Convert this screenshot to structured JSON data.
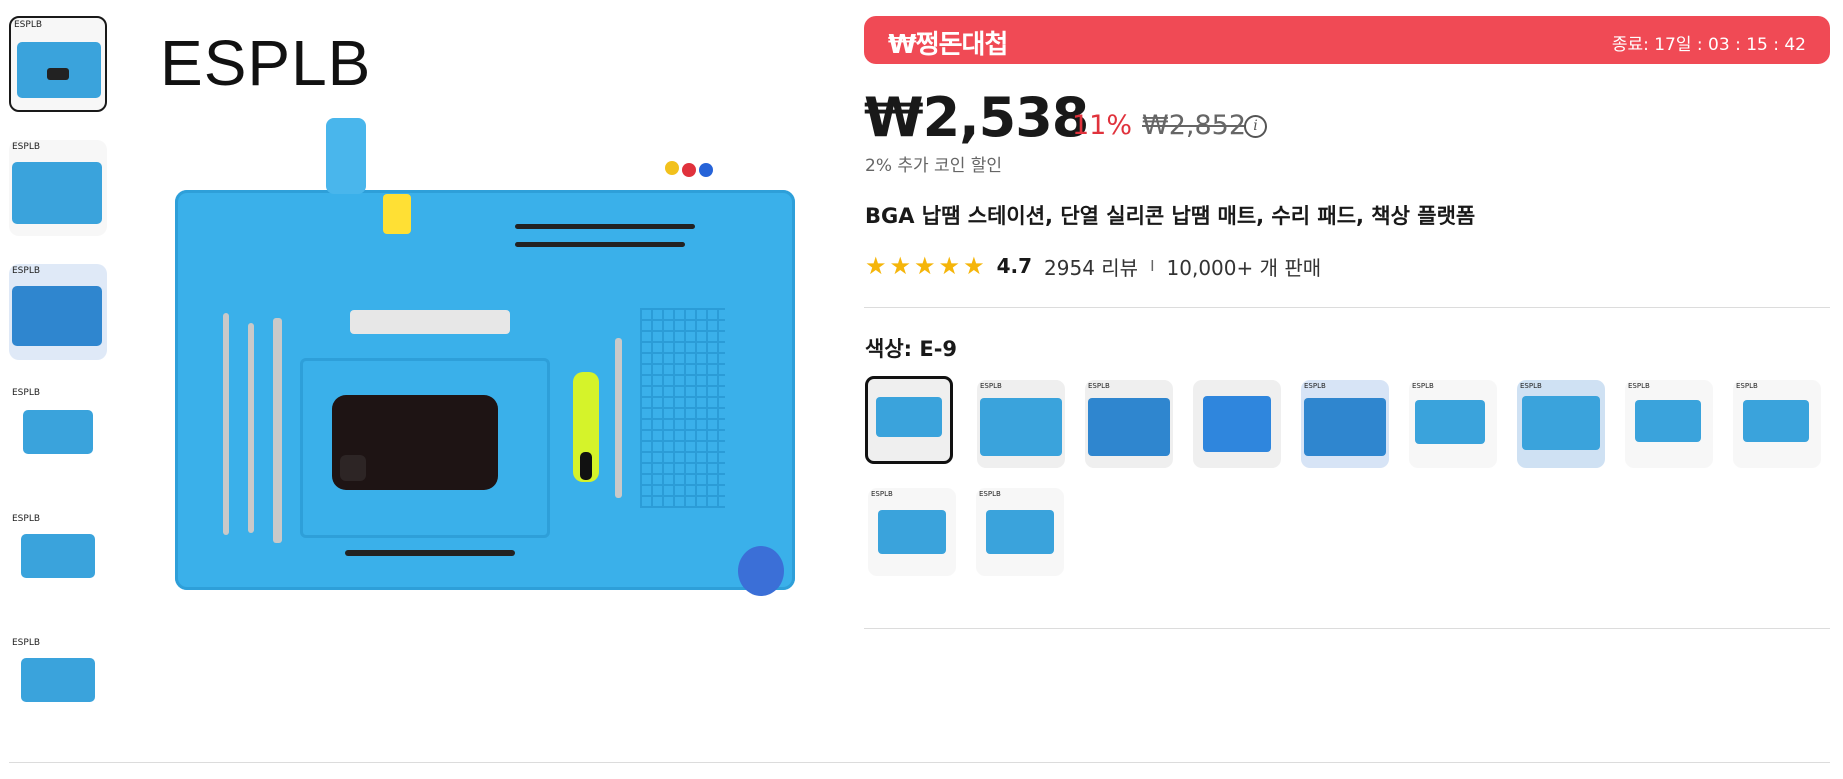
{
  "gallery": {
    "main_brand": "ESPLB",
    "thumbnails": [
      {
        "brand": "ESPLB",
        "note": "",
        "selected": true
      },
      {
        "brand": "ESPLB",
        "note": "",
        "selected": false
      },
      {
        "brand": "ESPLB",
        "note": "",
        "selected": false
      },
      {
        "brand": "ESPLB",
        "note": "",
        "selected": false
      },
      {
        "brand": "ESPLB",
        "note": "",
        "selected": false
      },
      {
        "brand": "ESPLB",
        "note": "",
        "selected": false
      }
    ]
  },
  "promo": {
    "logo": "₩쩡돈대첩",
    "timer": "종료: 17일 : 03 : 15 : 42",
    "color": "#f04a55"
  },
  "pricing": {
    "price": "₩2,538",
    "discount": "11%",
    "original_price": "₩2,852",
    "info_icon": "i",
    "coin_discount": "2% 추가 코인 할인"
  },
  "product": {
    "title": "BGA 납땜 스테이션, 단열 실리콘 납땜 매트, 수리 패드, 책상 플랫폼",
    "rating": "4.7",
    "stars": 5,
    "reviews": "2954 리뷰",
    "separator": "I",
    "sold": "10,000+ 개 판매"
  },
  "color": {
    "label": "색상: E-9",
    "options": [
      {
        "brand": "",
        "selected": true
      },
      {
        "brand": "ESPLB",
        "selected": false
      },
      {
        "brand": "ESPLB",
        "selected": false
      },
      {
        "brand": "",
        "selected": false
      },
      {
        "brand": "ESPLB",
        "selected": false
      },
      {
        "brand": "ESPLB",
        "selected": false
      },
      {
        "brand": "ESPLB",
        "selected": false
      },
      {
        "brand": "ESPLB",
        "selected": false
      },
      {
        "brand": "ESPLB",
        "selected": false
      },
      {
        "brand": "ESPLB",
        "selected": false
      },
      {
        "brand": "ESPLB",
        "selected": false
      }
    ]
  },
  "colors": {
    "accent_red": "#e0323c",
    "star": "#f5b50a",
    "mat_blue": "#3ab0ea"
  }
}
